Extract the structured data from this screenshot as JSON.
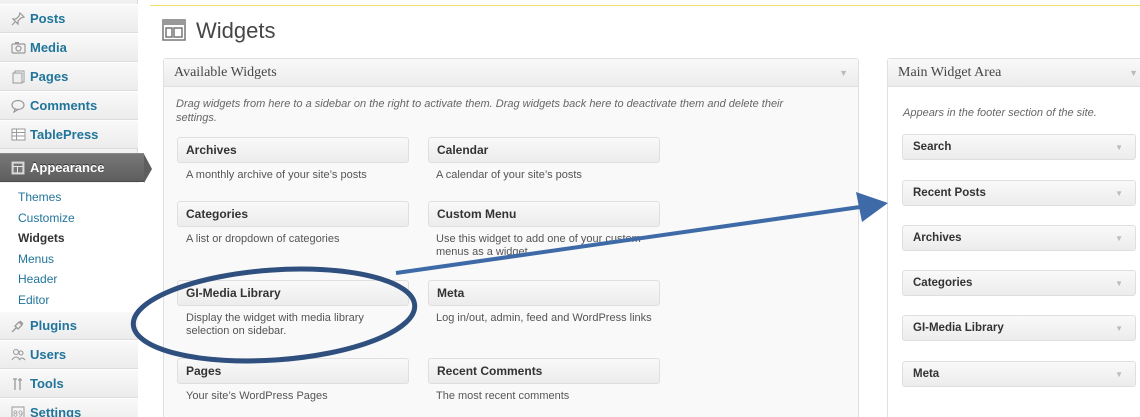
{
  "sidebar": {
    "items": [
      {
        "label": "Posts",
        "icon": "pushpin-icon"
      },
      {
        "label": "Media",
        "icon": "camera-icon"
      },
      {
        "label": "Pages",
        "icon": "page-icon"
      },
      {
        "label": "Comments",
        "icon": "comment-bubble-icon"
      },
      {
        "label": "TablePress",
        "icon": "table-icon"
      },
      {
        "label": "Appearance",
        "icon": "layout-icon"
      },
      {
        "label": "Plugins",
        "icon": "plug-icon"
      },
      {
        "label": "Users",
        "icon": "users-icon"
      },
      {
        "label": "Tools",
        "icon": "tools-icon"
      },
      {
        "label": "Settings",
        "icon": "settings-icon"
      }
    ],
    "submenu": [
      "Themes",
      "Customize",
      "Widgets",
      "Menus",
      "Header",
      "Editor"
    ],
    "current_submenu": "Widgets"
  },
  "header": {
    "title": "Widgets"
  },
  "available": {
    "title": "Available Widgets",
    "description": "Drag widgets from here to a sidebar on the right to activate them. Drag widgets back here to deactivate them and delete their settings.",
    "widgets": [
      {
        "title": "Archives",
        "desc": "A monthly archive of your site’s posts"
      },
      {
        "title": "Calendar",
        "desc": "A calendar of your site’s posts"
      },
      {
        "title": "Categories",
        "desc": "A list or dropdown of categories"
      },
      {
        "title": "Custom Menu",
        "desc": "Use this widget to add one of your custom menus as a widget."
      },
      {
        "title": "GI-Media Library",
        "desc": "Display the widget with media library selection on sidebar."
      },
      {
        "title": "Meta",
        "desc": "Log in/out, admin, feed and WordPress links"
      },
      {
        "title": "Pages",
        "desc": "Your site’s WordPress Pages"
      },
      {
        "title": "Recent Comments",
        "desc": "The most recent comments"
      }
    ]
  },
  "main_area": {
    "title": "Main Widget Area",
    "description": "Appears in the footer section of the site.",
    "widgets": [
      "Search",
      "Recent Posts",
      "Archives",
      "Categories",
      "GI-Media Library",
      "Meta"
    ]
  },
  "colors": {
    "link": "#21759b",
    "annotation": "#2f4f7f",
    "active_menu": "#5e5e5e",
    "highlight_line": "#f0e06a"
  }
}
